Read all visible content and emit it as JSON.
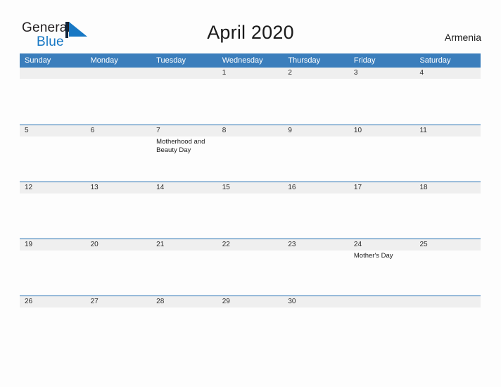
{
  "brand": {
    "word_one": "General",
    "word_two": "Blue",
    "mark_name": "triangle-logo-mark",
    "color_primary": "#1878c4",
    "color_text": "#231f20"
  },
  "header": {
    "title": "April 2020",
    "country": "Armenia"
  },
  "theme": {
    "header_blue": "#3b7ebc",
    "divider_blue": "#1f6cb0",
    "number_band_gray": "#efefef",
    "page_background": "#fdfdfd"
  },
  "calendar": {
    "weekdays": [
      "Sunday",
      "Monday",
      "Tuesday",
      "Wednesday",
      "Thursday",
      "Friday",
      "Saturday"
    ],
    "weeks": [
      {
        "days": [
          {
            "num": "",
            "events": []
          },
          {
            "num": "",
            "events": []
          },
          {
            "num": "",
            "events": []
          },
          {
            "num": "1",
            "events": []
          },
          {
            "num": "2",
            "events": []
          },
          {
            "num": "3",
            "events": []
          },
          {
            "num": "4",
            "events": []
          }
        ]
      },
      {
        "days": [
          {
            "num": "5",
            "events": []
          },
          {
            "num": "6",
            "events": []
          },
          {
            "num": "7",
            "events": [
              "Motherhood and Beauty Day"
            ]
          },
          {
            "num": "8",
            "events": []
          },
          {
            "num": "9",
            "events": []
          },
          {
            "num": "10",
            "events": []
          },
          {
            "num": "11",
            "events": []
          }
        ]
      },
      {
        "days": [
          {
            "num": "12",
            "events": []
          },
          {
            "num": "13",
            "events": []
          },
          {
            "num": "14",
            "events": []
          },
          {
            "num": "15",
            "events": []
          },
          {
            "num": "16",
            "events": []
          },
          {
            "num": "17",
            "events": []
          },
          {
            "num": "18",
            "events": []
          }
        ]
      },
      {
        "days": [
          {
            "num": "19",
            "events": []
          },
          {
            "num": "20",
            "events": []
          },
          {
            "num": "21",
            "events": []
          },
          {
            "num": "22",
            "events": []
          },
          {
            "num": "23",
            "events": []
          },
          {
            "num": "24",
            "events": [
              "Mother's Day"
            ]
          },
          {
            "num": "25",
            "events": []
          }
        ]
      },
      {
        "days": [
          {
            "num": "26",
            "events": []
          },
          {
            "num": "27",
            "events": []
          },
          {
            "num": "28",
            "events": []
          },
          {
            "num": "29",
            "events": []
          },
          {
            "num": "30",
            "events": []
          },
          {
            "num": "",
            "events": []
          },
          {
            "num": "",
            "events": []
          }
        ]
      }
    ]
  }
}
